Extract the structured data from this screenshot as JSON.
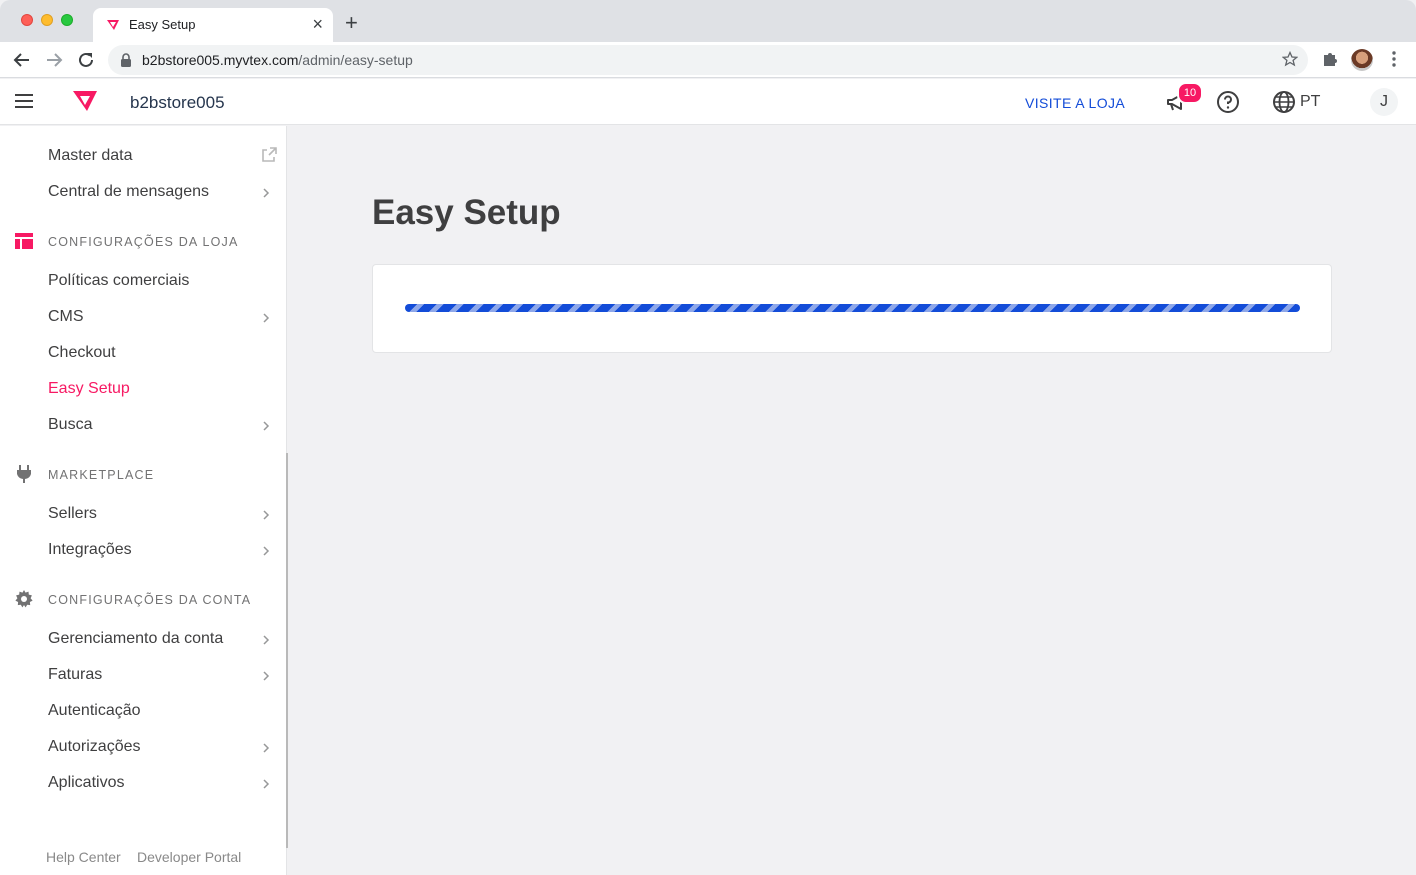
{
  "browser": {
    "tab_title": "Easy Setup",
    "url_host": "b2bstore005.myvtex.com",
    "url_path": "/admin/easy-setup"
  },
  "header": {
    "store_name": "b2bstore005",
    "visit_store": "VISITE A LOJA",
    "notification_count": "10",
    "language": "PT",
    "user_initial": "J"
  },
  "sidebar": {
    "top_items": [
      {
        "label": "Master data"
      },
      {
        "label": "Central de mensagens"
      }
    ],
    "sections": [
      {
        "title": "CONFIGURAÇÕES DA LOJA",
        "items": [
          {
            "label": "Políticas comerciais"
          },
          {
            "label": "CMS"
          },
          {
            "label": "Checkout"
          },
          {
            "label": "Easy Setup"
          },
          {
            "label": "Busca"
          }
        ]
      },
      {
        "title": "MARKETPLACE",
        "items": [
          {
            "label": "Sellers"
          },
          {
            "label": "Integrações"
          }
        ]
      },
      {
        "title": "CONFIGURAÇÕES DA CONTA",
        "items": [
          {
            "label": "Gerenciamento da conta"
          },
          {
            "label": "Faturas"
          },
          {
            "label": "Autenticação"
          },
          {
            "label": "Autorizações"
          },
          {
            "label": "Aplicativos"
          }
        ]
      }
    ],
    "footer": {
      "help_center": "Help Center",
      "developer_portal": "Developer Portal"
    }
  },
  "main": {
    "title": "Easy Setup",
    "progress": {
      "state": "indeterminate"
    }
  },
  "colors": {
    "accent": "#f71963",
    "link": "#134cd8",
    "progress": "#134cd8"
  }
}
